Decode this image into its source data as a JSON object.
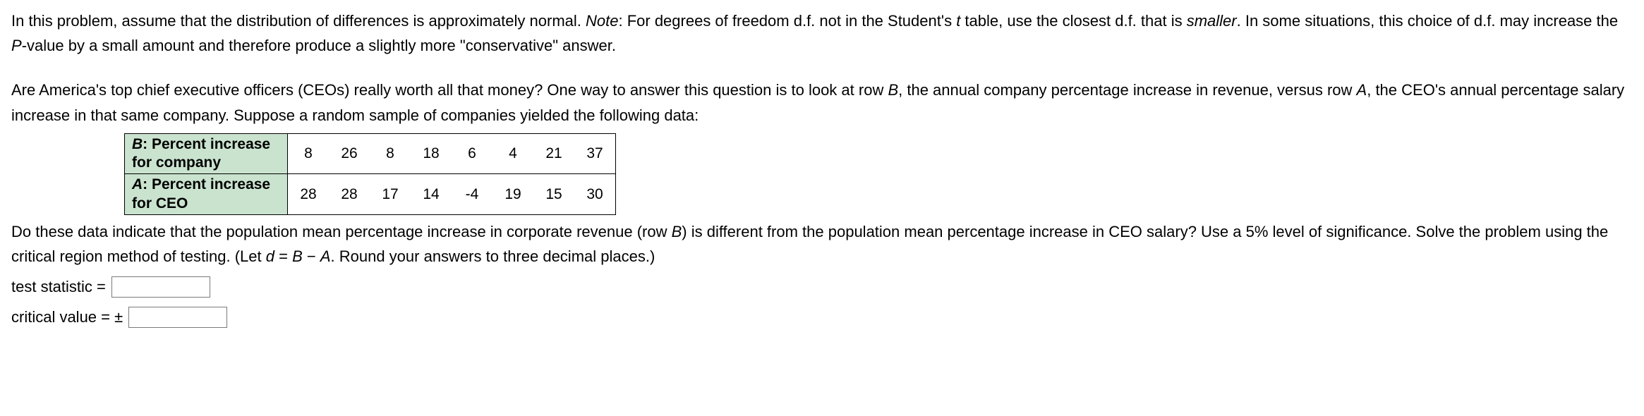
{
  "intro": {
    "part1": "In this problem, assume that the distribution of differences is approximately normal. ",
    "note_label": "Note",
    "part2": ": For degrees of freedom d.f. not in the Student's ",
    "tvar": "t",
    "part3": " table, use the closest d.f. that is ",
    "smaller": "smaller",
    "part4": ". In some situations, this choice of d.f. may increase the ",
    "pval": "P",
    "part5": "-value by a small amount and therefore produce a slightly more \"conservative\" answer."
  },
  "context": {
    "part1": "Are America's top chief executive officers (CEOs) really worth all that money? One way to answer this question is to look at row ",
    "bvar": "B",
    "part2": ", the annual company percentage increase in revenue, versus row ",
    "avar": "A",
    "part3": ", the CEO's annual percentage salary increase in that same company. Suppose a random sample of companies yielded the following data:"
  },
  "table": {
    "rowB_header_l1": "B",
    "rowB_header_l2": ": Percent increase",
    "rowB_header_l3": "for company",
    "rowA_header_l1": "A",
    "rowA_header_l2": ": Percent increase",
    "rowA_header_l3": "for CEO",
    "rowB": [
      "8",
      "26",
      "8",
      "18",
      "6",
      "4",
      "21",
      "37"
    ],
    "rowA": [
      "28",
      "28",
      "17",
      "14",
      "-4",
      "19",
      "15",
      "30"
    ]
  },
  "question": {
    "part1": "Do these data indicate that the population mean percentage increase in corporate revenue (row ",
    "bvar": "B",
    "part2": ") is different from the population mean percentage increase in CEO salary? Use a 5% level of significance. Solve the problem using the critical region method of testing. (Let ",
    "dvar": "d",
    "eq": " = ",
    "bvar2": "B",
    "minus": " − ",
    "avar": "A",
    "part3": ". Round your answers to three decimal places.)"
  },
  "inputs": {
    "test_stat_label": "test statistic =",
    "crit_val_label": "critical value = ±",
    "test_stat_value": "",
    "crit_val_value": ""
  }
}
